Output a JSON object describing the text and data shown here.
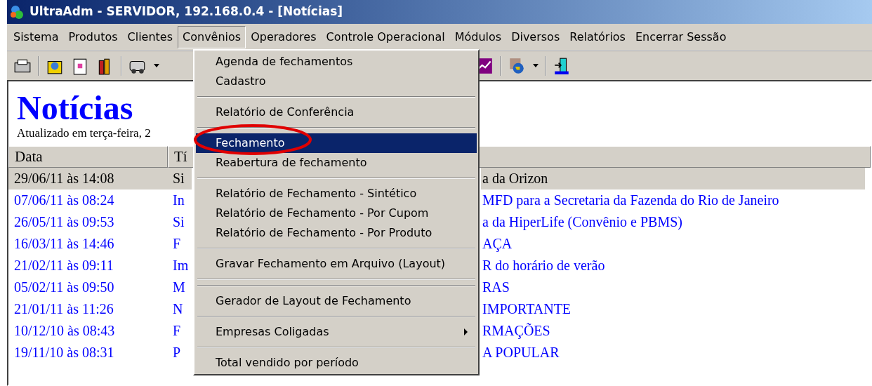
{
  "window": {
    "title": "UltraAdm - SERVIDOR, 192.168.0.4 - [Notícias]"
  },
  "menu_bar": [
    {
      "label": "Sistema",
      "selected": false
    },
    {
      "label": "Produtos",
      "selected": false
    },
    {
      "label": "Clientes",
      "selected": false
    },
    {
      "label": "Convênios",
      "selected": true
    },
    {
      "label": "Operadores",
      "selected": false
    },
    {
      "label": "Controle Operacional",
      "selected": false
    },
    {
      "label": "Módulos",
      "selected": false
    },
    {
      "label": "Diversos",
      "selected": false
    },
    {
      "label": "Relatórios",
      "selected": false
    },
    {
      "label": "Encerrar Sessão",
      "selected": false
    }
  ],
  "dropdown_menu": {
    "items": [
      {
        "kind": "item",
        "label": "Agenda de fechamentos",
        "selected": false,
        "submenu": false
      },
      {
        "kind": "item",
        "label": "Cadastro",
        "selected": false,
        "submenu": false
      },
      {
        "kind": "separator"
      },
      {
        "kind": "item",
        "label": "Relatório de Conferência",
        "selected": false,
        "submenu": false
      },
      {
        "kind": "separator"
      },
      {
        "kind": "item",
        "label": "Fechamento",
        "selected": true,
        "submenu": false
      },
      {
        "kind": "item",
        "label": "Reabertura de fechamento",
        "selected": false,
        "submenu": false
      },
      {
        "kind": "separator"
      },
      {
        "kind": "item",
        "label": "Relatório de Fechamento - Sintético",
        "selected": false,
        "submenu": false
      },
      {
        "kind": "item",
        "label": "Relatório de Fechamento - Por Cupom",
        "selected": false,
        "submenu": false
      },
      {
        "kind": "item",
        "label": "Relatório de Fechamento - Por Produto",
        "selected": false,
        "submenu": false
      },
      {
        "kind": "separator"
      },
      {
        "kind": "item",
        "label": "Gravar Fechamento em Arquivo (Layout)",
        "selected": false,
        "submenu": false
      },
      {
        "kind": "separator"
      },
      {
        "kind": "separator"
      },
      {
        "kind": "item",
        "label": "Gerador de Layout de Fechamento",
        "selected": false,
        "submenu": false
      },
      {
        "kind": "separator"
      },
      {
        "kind": "item",
        "label": "Empresas Coligadas",
        "selected": false,
        "submenu": true
      },
      {
        "kind": "separator"
      },
      {
        "kind": "item",
        "label": "Total vendido por período",
        "selected": false,
        "submenu": false
      }
    ]
  },
  "page": {
    "heading": "Notícias",
    "updated": "Atualizado em terça-feira, 2"
  },
  "table": {
    "columns": [
      "Data",
      "Tí"
    ],
    "rows": [
      {
        "date": "29/06/11 às 14:08",
        "title_start": "Si",
        "title_end": "a da Orizon",
        "selected": true
      },
      {
        "date": "07/06/11 às 08:24",
        "title_start": "In",
        "title_end": "MFD para a Secretaria da Fazenda do Rio de Janeiro",
        "selected": false
      },
      {
        "date": "26/05/11 às 09:53",
        "title_start": "Si",
        "title_end": "a da HiperLife (Convênio e PBMS)",
        "selected": false
      },
      {
        "date": "16/03/11 às 14:46",
        "title_start": "F",
        "title_end": "AÇA",
        "selected": false
      },
      {
        "date": "21/02/11 às 09:11",
        "title_start": "Im",
        "title_end": "R do horário de verão",
        "selected": false
      },
      {
        "date": "05/02/11 às 09:50",
        "title_start": "M",
        "title_end": "RAS",
        "selected": false
      },
      {
        "date": "21/01/11 às 11:26",
        "title_start": "N",
        "title_end": "IMPORTANTE",
        "selected": false
      },
      {
        "date": "10/12/10 às 08:43",
        "title_start": "F",
        "title_end": "RMAÇÕES",
        "selected": false
      },
      {
        "date": "19/11/10 às 08:31",
        "title_start": "P",
        "title_end": "A POPULAR",
        "selected": false
      }
    ]
  }
}
